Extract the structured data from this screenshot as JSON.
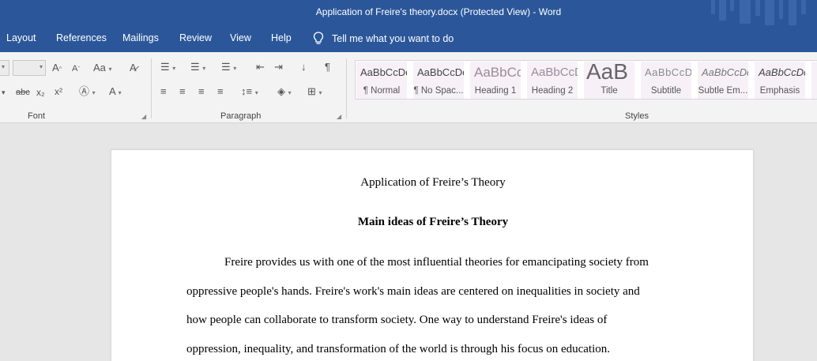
{
  "window": {
    "title": "Application of Freire's theory.docx (Protected View)  -  Word"
  },
  "menu": {
    "tabs": [
      "Layout",
      "References",
      "Mailings",
      "Review",
      "View",
      "Help"
    ],
    "tell_me": "Tell me what you want to do"
  },
  "ribbon": {
    "groups": {
      "font": "Font",
      "paragraph": "Paragraph",
      "styles": "Styles"
    },
    "styles_gallery": [
      {
        "sample": "AaBbCcDc",
        "name": "¶ Normal"
      },
      {
        "sample": "AaBbCcDc",
        "name": "¶ No Spac..."
      },
      {
        "sample": "AaBbCc",
        "name": "Heading 1"
      },
      {
        "sample": "AaBbCcD",
        "name": "Heading 2"
      },
      {
        "sample": "AaB",
        "name": "Title"
      },
      {
        "sample": "AaBbCcD",
        "name": "Subtitle"
      },
      {
        "sample": "AaBbCcDc",
        "name": "Subtle Em..."
      },
      {
        "sample": "AaBbCcDc",
        "name": "Emphasis"
      }
    ]
  },
  "document": {
    "title": "Application of Freire’s Theory",
    "heading": "Main ideas of Freire’s Theory",
    "paragraph_lines": [
      "Freire provides us with one of the most influential theories for emancipating society from",
      "oppressive people's hands. Freire's work's main ideas are centered on inequalities in society and",
      "how people can collaborate to transform society. One way to understand Freire's ideas of",
      "oppression, inequality, and transformation of the world is through his focus on education."
    ]
  }
}
